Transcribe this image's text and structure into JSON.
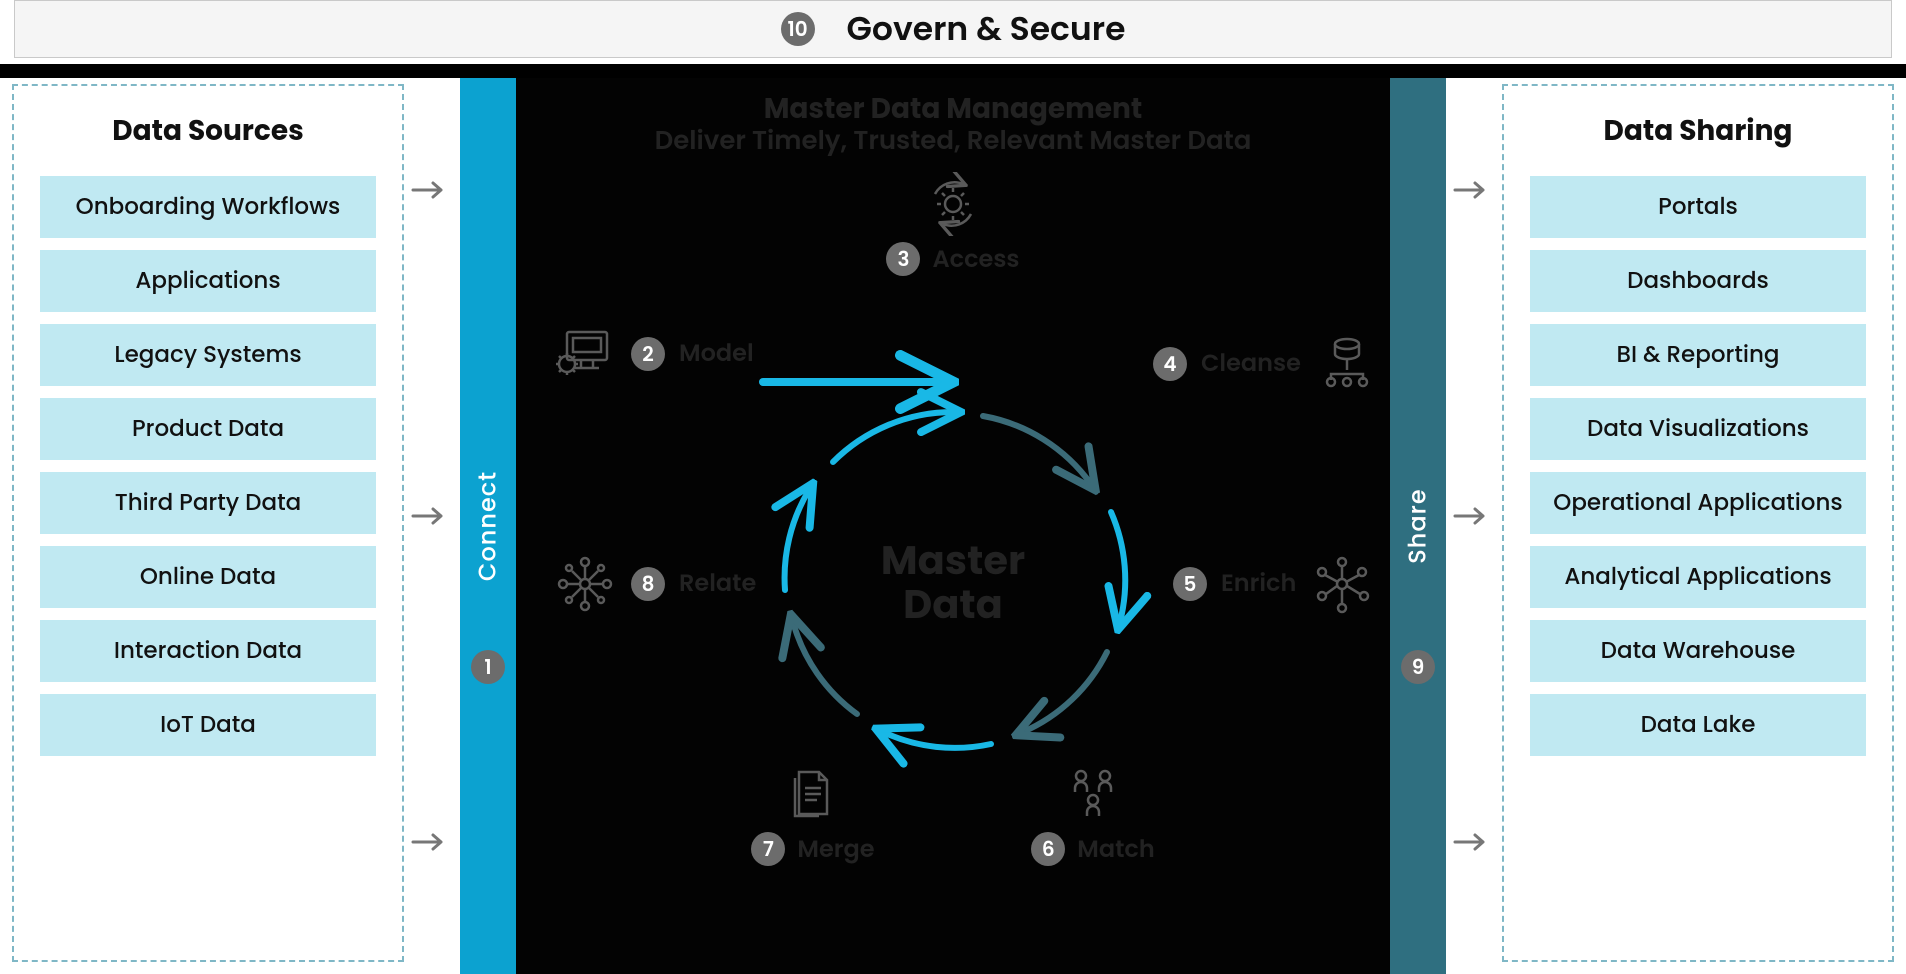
{
  "top": {
    "num": "10",
    "label": "Govern & Secure"
  },
  "left_panel": {
    "title": "Data Sources",
    "items": [
      "Onboarding Workflows",
      "Applications",
      "Legacy Systems",
      "Product Data",
      "Third Party Data",
      "Online Data",
      "Interaction Data",
      "IoT Data"
    ]
  },
  "right_panel": {
    "title": "Data Sharing",
    "items": [
      "Portals",
      "Dashboards",
      "BI & Reporting",
      "Data Visualizations",
      "Operational Applications",
      "Analytical Applications",
      "Data Warehouse",
      "Data Lake"
    ]
  },
  "vbars": {
    "connect": {
      "num": "1",
      "label": "Connect"
    },
    "share": {
      "num": "9",
      "label": "Share"
    }
  },
  "center": {
    "title_line1": "Master Data Management",
    "title_line2": "Deliver Timely, Trusted, Relevant Master Data",
    "hub_line1": "Master",
    "hub_line2": "Data",
    "steps": [
      {
        "num": "2",
        "label": "Model",
        "icon": "monitor-gear-icon"
      },
      {
        "num": "3",
        "label": "Access",
        "icon": "gear-cycle-icon"
      },
      {
        "num": "4",
        "label": "Cleanse",
        "icon": "db-network-icon"
      },
      {
        "num": "5",
        "label": "Enrich",
        "icon": "radial-nodes-icon"
      },
      {
        "num": "6",
        "label": "Match",
        "icon": "people-group-icon"
      },
      {
        "num": "7",
        "label": "Merge",
        "icon": "documents-icon"
      },
      {
        "num": "8",
        "label": "Relate",
        "icon": "hub-nodes-icon"
      }
    ]
  }
}
